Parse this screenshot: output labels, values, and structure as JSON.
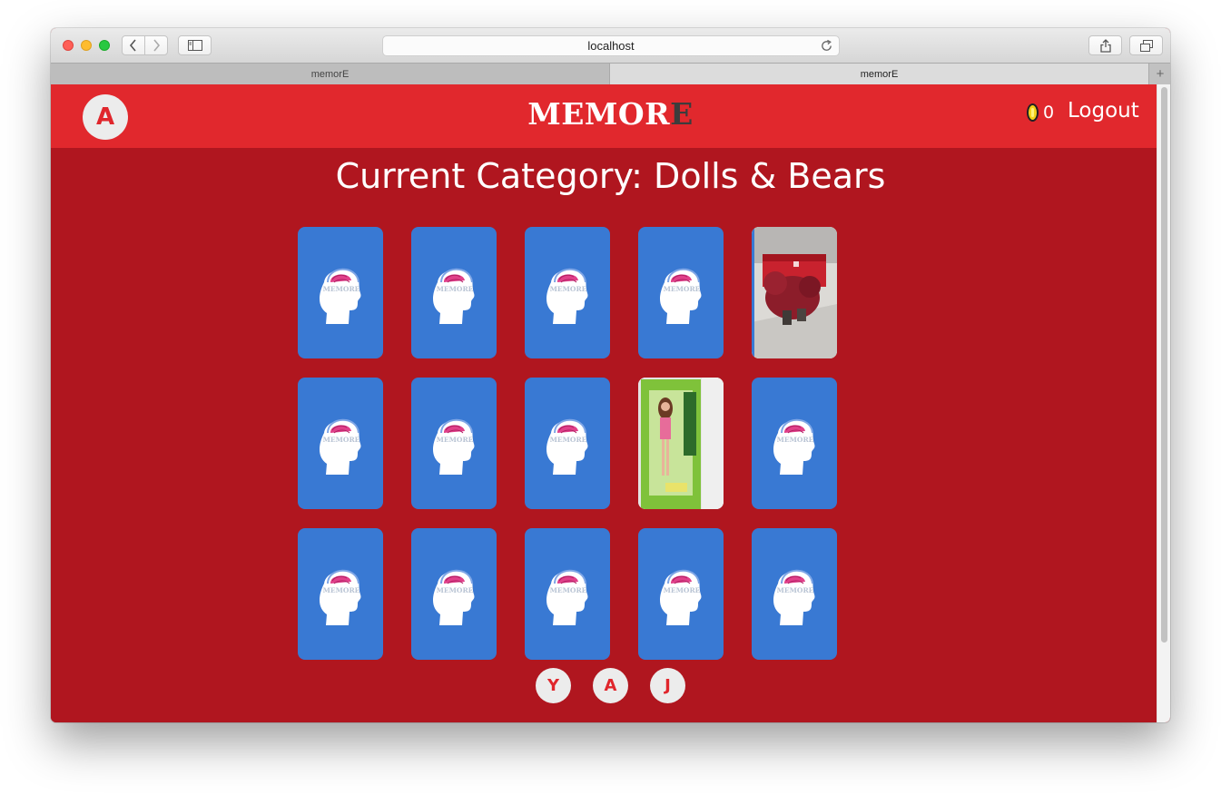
{
  "browser": {
    "url": "localhost",
    "tabs": [
      {
        "label": "memorE",
        "active": false
      },
      {
        "label": "memorE",
        "active": true
      }
    ],
    "new_tab_symbol": "+"
  },
  "header": {
    "user_initial": "A",
    "logo_main": "MEMOR",
    "logo_accent": "E",
    "coin_count": "0",
    "logout_label": "Logout"
  },
  "main": {
    "category_title": "Current Category: Dolls & Bears",
    "card_back_logo": "MEMORE",
    "cards": [
      {
        "state": "face-down"
      },
      {
        "state": "face-down"
      },
      {
        "state": "face-down"
      },
      {
        "state": "face-down"
      },
      {
        "state": "revealed",
        "image": "red teddy bear in gift box"
      },
      {
        "state": "face-down"
      },
      {
        "state": "face-down"
      },
      {
        "state": "face-down"
      },
      {
        "state": "revealed",
        "image": "boxed doll"
      },
      {
        "state": "face-down"
      },
      {
        "state": "face-down"
      },
      {
        "state": "face-down"
      },
      {
        "state": "face-down"
      },
      {
        "state": "face-down"
      },
      {
        "state": "face-down"
      }
    ]
  },
  "players": [
    "Y",
    "A",
    "J"
  ],
  "colors": {
    "header_red": "#e1282d",
    "page_red": "#b0161f",
    "card_blue": "#3979d3",
    "avatar_bg": "#ececec",
    "avatar_text": "#e0262c"
  }
}
